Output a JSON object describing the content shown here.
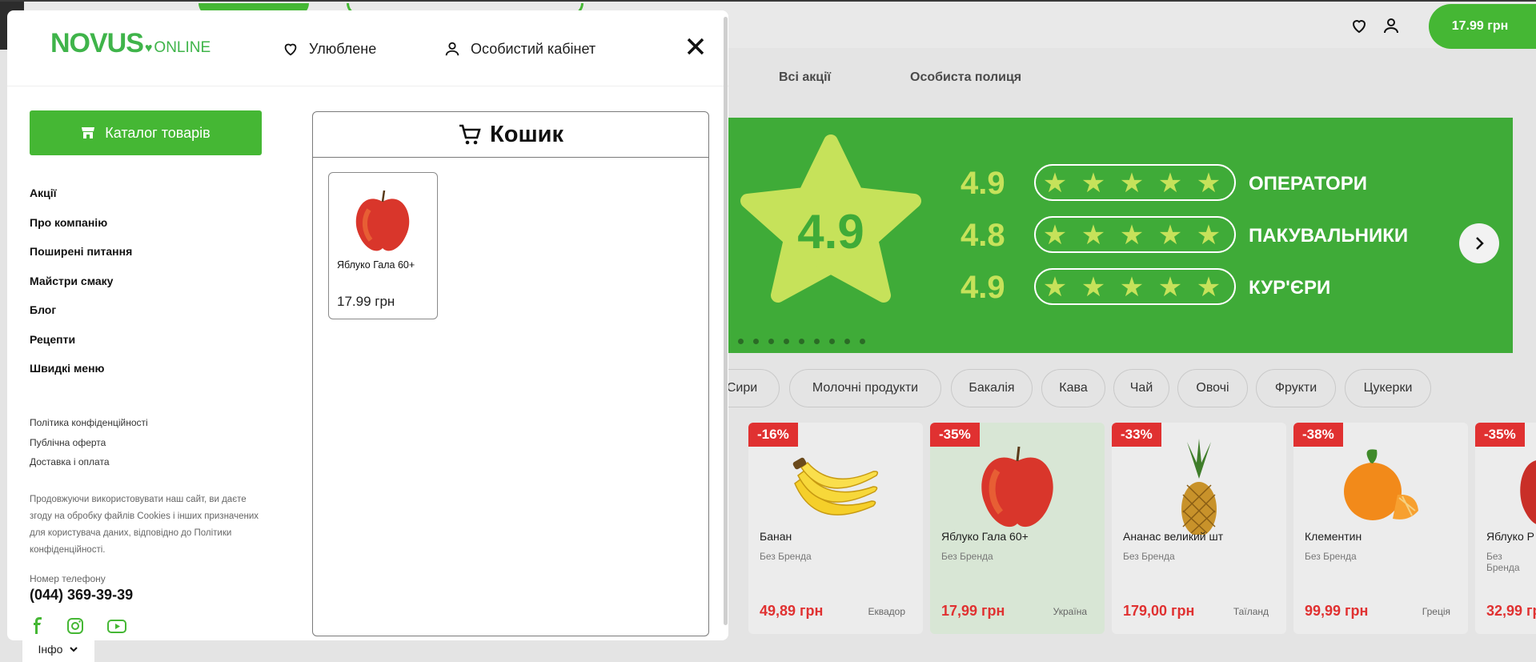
{
  "header": {
    "cart_total": "17.99 грн",
    "nav": [
      "Всі акції",
      "Особиста полиця"
    ]
  },
  "banner": {
    "star_value": "4.9",
    "ratings": [
      {
        "score": "4.9",
        "label": "ОПЕРАТОРИ",
        "stars": 5
      },
      {
        "score": "4.8",
        "label": "ПАКУВАЛЬНИКИ",
        "stars": 5
      },
      {
        "score": "4.9",
        "label": "КУР'ЄРИ",
        "stars": 5
      }
    ],
    "colors": {
      "background": "#3fab38",
      "accent": "#c6e25a"
    }
  },
  "categories": [
    "Сири",
    "Молочні продукти",
    "Бакалія",
    "Кава",
    "Чай",
    "Овочі",
    "Фрукти",
    "Цукерки"
  ],
  "products": [
    {
      "discount": "-16%",
      "name": "Банан",
      "brand": "Без Бренда",
      "price": "49,89 грн",
      "country": "Еквадор",
      "icon": "banana"
    },
    {
      "discount": "-35%",
      "name": "Яблуко Гала 60+",
      "brand": "Без Бренда",
      "price": "17,99 грн",
      "country": "Україна",
      "icon": "apple"
    },
    {
      "discount": "-33%",
      "name": "Ананас великий шт",
      "brand": "Без Бренда",
      "price": "179,00 грн",
      "country": "Таїланд",
      "icon": "pineapple"
    },
    {
      "discount": "-38%",
      "name": "Клементин",
      "brand": "Без Бренда",
      "price": "99,99 грн",
      "country": "Греція",
      "icon": "clementine"
    },
    {
      "discount": "-35%",
      "name": "Яблуко Р",
      "brand": "Без Бренда",
      "price": "32,99 гр",
      "country": "",
      "icon": "apple"
    }
  ],
  "info_tab": "Інфо",
  "drawer": {
    "logo_main": "NOVUS",
    "logo_sub": "ONLINE",
    "favorites": "Улюблене",
    "account": "Особистий кабінет",
    "catalog_button": "Каталог товарів",
    "menu": [
      "Акції",
      "Про компанію",
      "Поширені питання",
      "Майстри смаку",
      "Блог",
      "Рецепти",
      "Швидкі меню"
    ],
    "legal": [
      "Політика конфіденційності",
      "Публічна оферта",
      "Доставка і оплата"
    ],
    "cookie_text": "Продовжуючи використовувати наш сайт, ви даєте згоду на обробку файлів Cookies і інших призначених для користувача даних, відповідно до Політики конфіденційності.",
    "phone_label": "Номер телефону",
    "phone": "(044) 369-39-39",
    "social_icons": [
      "facebook-icon",
      "instagram-icon",
      "youtube-icon"
    ]
  },
  "cart": {
    "title": "Кошик",
    "items": [
      {
        "name": "Яблуко Гала 60+",
        "price": "17.99 грн",
        "icon": "apple"
      }
    ]
  },
  "colors": {
    "brand_green": "#45b734",
    "discount_red": "#e03131"
  }
}
